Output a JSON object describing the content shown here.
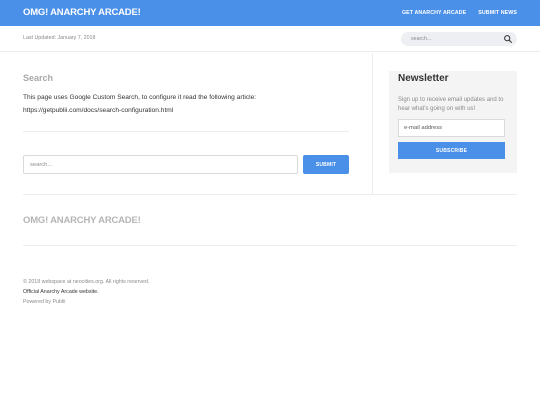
{
  "header": {
    "brand": "OMG! ANARCHY ARCADE!",
    "nav": [
      "GET ANARCHY ARCADE",
      "SUBMIT NEWS"
    ]
  },
  "subheader": {
    "last_updated": "Last Updated: January 7, 2018",
    "search_placeholder": "search...",
    "search_icon": "search-icon"
  },
  "main": {
    "title": "Search",
    "body_line1": "This page uses Google Custom Search, to configure it read the following article:",
    "body_url": "https://getpublii.com/docs/search-configuration.html",
    "search_placeholder": "search...",
    "submit_label": "SUBMIT"
  },
  "newsletter": {
    "title": "Newsletter",
    "description": "Sign up to receive email updates and to hear what's going on with us!",
    "email_placeholder": "e-mail address",
    "subscribe_label": "SUBSCRIBE"
  },
  "footer": {
    "brand": "OMG! ANARCHY ARCADE!",
    "copyright": "© 2018 webspace at neocities.org. All rights reserved.",
    "official": "Official Anarchy Arcade website.",
    "powered": "Powered by Publii"
  },
  "colors": {
    "accent": "#4a90e9",
    "muted_text": "#8a8a8a",
    "panel_bg": "#f4f4f4"
  }
}
